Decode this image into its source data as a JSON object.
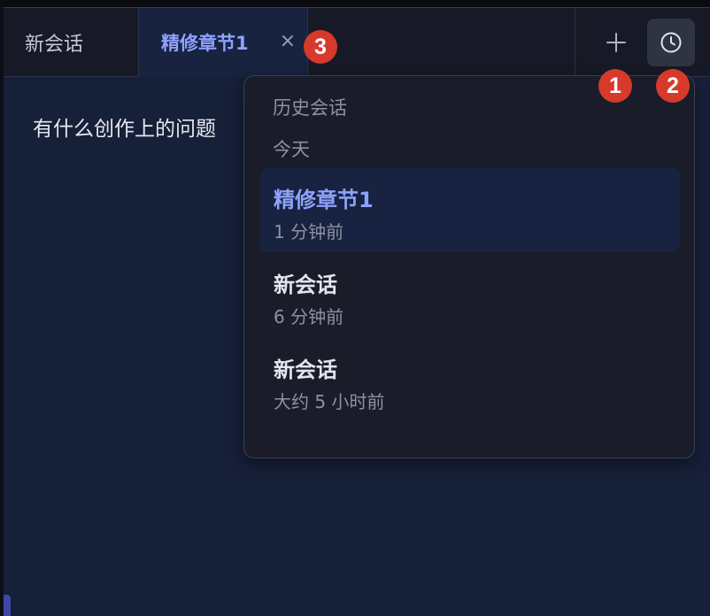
{
  "tabs": [
    {
      "label": "新会话",
      "active": false
    },
    {
      "label": "精修章节1",
      "active": true
    }
  ],
  "tab_close_glyph": "×",
  "toolbar": {
    "new_icon": "plus-icon",
    "history_icon": "clock-icon"
  },
  "annotations": {
    "badge_1": "1",
    "badge_2": "2",
    "badge_3": "3"
  },
  "main": {
    "prompt": "有什么创作上的问题"
  },
  "history": {
    "title": "历史会话",
    "group_label": "今天",
    "items": [
      {
        "title": "精修章节1",
        "time": "1 分钟前",
        "active": true
      },
      {
        "title": "新会话",
        "time": "6 分钟前",
        "active": false
      },
      {
        "title": "新会话",
        "time": "大约 5 小时前",
        "active": false
      }
    ]
  },
  "colors": {
    "accent": "#8ea2ff",
    "badge": "#d7392b",
    "background": "#172039"
  }
}
